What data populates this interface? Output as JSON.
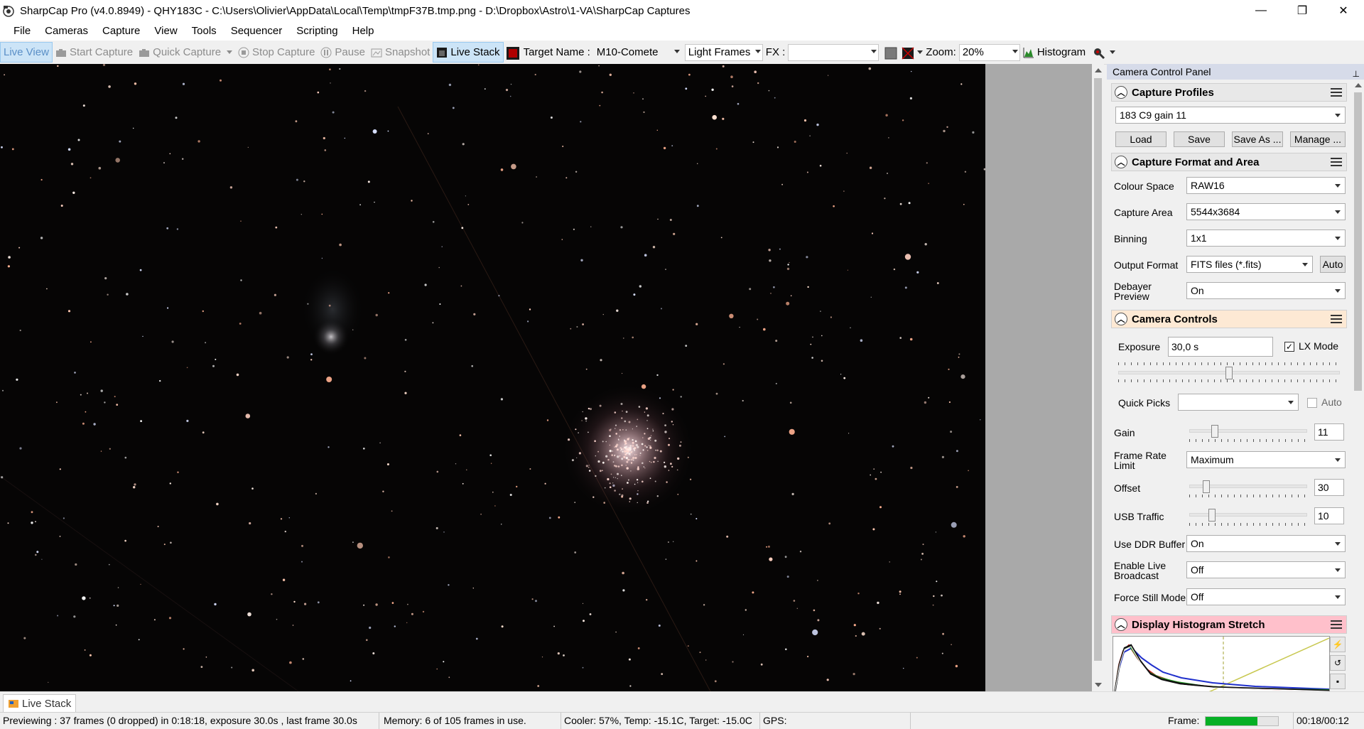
{
  "window": {
    "title": "SharpCap Pro (v4.0.8949) - QHY183C - C:\\Users\\Olivier\\AppData\\Local\\Temp\\tmpF37B.tmp.png - D:\\Dropbox\\Astro\\1-VA\\SharpCap Captures",
    "minimize": "—",
    "restore": "❐",
    "close": "✕"
  },
  "menu": [
    "File",
    "Cameras",
    "Capture",
    "View",
    "Tools",
    "Sequencer",
    "Scripting",
    "Help"
  ],
  "toolbar": {
    "live_view": "Live View",
    "start_capture": "Start Capture",
    "quick_capture": "Quick Capture",
    "stop_capture": "Stop Capture",
    "pause": "Pause",
    "snapshot": "Snapshot",
    "live_stack": "Live Stack",
    "target_name_label": "Target Name :",
    "target_name_value": "M10-Comete",
    "frame_type": "Light Frames",
    "fx_label": "FX :",
    "fx_value": "",
    "zoom_label": "Zoom:",
    "zoom_value": "20%",
    "histogram": "Histogram"
  },
  "panel": {
    "header": "Camera Control Panel",
    "capture_profiles": {
      "title": "Capture Profiles",
      "selected": "183 C9 gain 11",
      "buttons": [
        "Load",
        "Save",
        "Save As ...",
        "Manage ..."
      ]
    },
    "capture_format": {
      "title": "Capture Format and Area",
      "colour_space_label": "Colour Space",
      "colour_space": "RAW16",
      "capture_area_label": "Capture Area",
      "capture_area": "5544x3684",
      "binning_label": "Binning",
      "binning": "1x1",
      "output_format_label": "Output Format",
      "output_format": "FITS files (*.fits)",
      "auto_button": "Auto",
      "debayer_label_1": "Debayer",
      "debayer_label_2": "Preview",
      "debayer": "On"
    },
    "camera_controls": {
      "title": "Camera Controls",
      "exposure_label": "Exposure",
      "exposure": "30,0 s",
      "lx_mode_label": "LX Mode",
      "lx_mode_checked": true,
      "exposure_slider_fraction": 0.5,
      "quick_picks_label": "Quick Picks",
      "quick_picks": "",
      "auto_label": "Auto",
      "gain_label": "Gain",
      "gain": "11",
      "gain_fraction": 0.2,
      "frame_rate_label_1": "Frame Rate",
      "frame_rate_label_2": "Limit",
      "frame_rate": "Maximum",
      "offset_label": "Offset",
      "offset": "30",
      "offset_fraction": 0.12,
      "usb_label": "USB Traffic",
      "usb": "10",
      "usb_fraction": 0.17,
      "ddr_label": "Use DDR Buffer",
      "ddr": "On",
      "broadcast_label_1": "Enable Live",
      "broadcast_label_2": "Broadcast",
      "broadcast": "Off",
      "still_label": "Force Still Mode",
      "still": "Off"
    },
    "histogram_stretch": {
      "title": "Display Histogram Stretch"
    }
  },
  "bottom_tab": "Live Stack",
  "status": {
    "preview": "Previewing : 37 frames (0 dropped) in 0:18:18, exposure 30.0s , last frame 30.0s",
    "memory": "Memory: 6 of 105 frames in use.",
    "cooler": "Cooler: 57%, Temp: -15.1C, Target: -15.0C",
    "gps": "GPS:",
    "frame_label": "Frame:",
    "frame_progress": 0.72,
    "time": "00:18/00:12"
  },
  "colors": {
    "accent": "#cce4f7",
    "camera_controls_header": "#fde9d4",
    "histogram_header": "#ffc0cb",
    "panel_header": "#d6dbe9",
    "progress": "#06b025"
  }
}
